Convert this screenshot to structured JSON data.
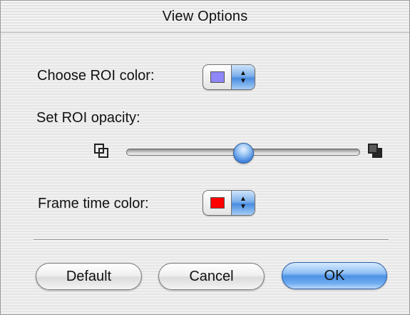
{
  "window": {
    "title": "View Options"
  },
  "roi_color": {
    "label": "Choose ROI color:",
    "swatch_color": "#8f86f7",
    "arrows_icon": "up-down-arrows-icon"
  },
  "roi_opacity": {
    "label": "Set ROI opacity:",
    "value_fraction": 0.5,
    "min_icon": "transparent-squares-icon",
    "max_icon": "opaque-squares-icon"
  },
  "frame_time_color": {
    "label": "Frame time color:",
    "swatch_color": "#ff0000",
    "arrows_icon": "up-down-arrows-icon"
  },
  "buttons": {
    "default_label": "Default",
    "cancel_label": "Cancel",
    "ok_label": "OK"
  },
  "colors": {
    "accent_blue": "#4c92e6"
  }
}
